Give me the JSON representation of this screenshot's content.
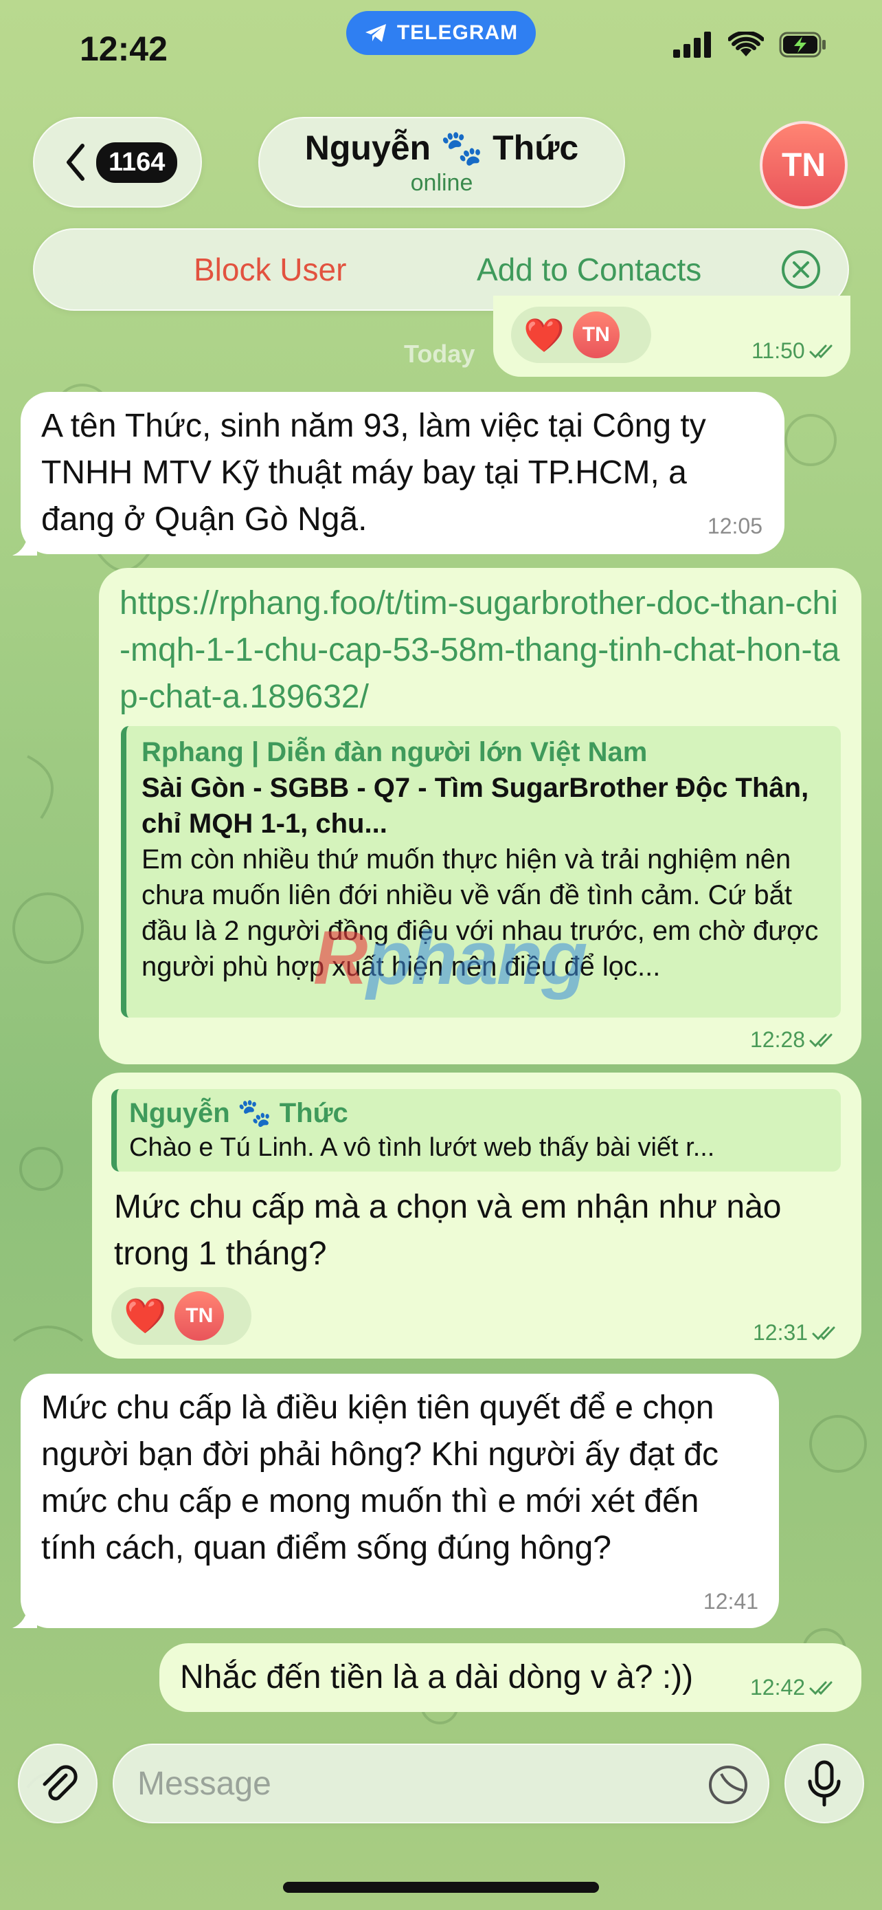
{
  "status_bar": {
    "time": "12:42",
    "source_pill": "TELEGRAM"
  },
  "header": {
    "back_count": "1164",
    "contact_name": "Nguyễn 🐾 Thức",
    "contact_status": "online",
    "avatar_initials": "TN"
  },
  "action_bar": {
    "block_label": "Block User",
    "add_label": "Add to Contacts"
  },
  "date_label": "Today",
  "messages": [
    {
      "id": "m0",
      "direction": "out",
      "time": "11:50",
      "reaction": "❤️",
      "reaction_avatar": "TN"
    },
    {
      "id": "m1",
      "direction": "in",
      "text": "A tên Thức, sinh năm 93, làm việc tại Công ty TNHH MTV Kỹ thuật máy bay tại TP.HCM, a đang ở Quận Gò Ngã.",
      "time": "12:05"
    },
    {
      "id": "m2",
      "direction": "out",
      "link": "https://rphang.foo/t/tim-sugarbrother-doc-than-chi-mqh-1-1-chu-cap-53-58m-thang-tinh-chat-hon-tap-chat-a.189632/",
      "preview": {
        "site": "Rphang | Diễn đàn người lớn Việt Nam",
        "title": "Sài Gòn - SGBB - Q7 - Tìm SugarBrother Độc Thân, chỉ MQH 1-1, chu...",
        "description": "Em còn nhiều thứ muốn thực hiện và trải nghiệm nên chưa muốn liên đới nhiều về vấn đề tình cảm. Cứ bắt đầu là 2 người đồng điệu với nhau trước, em chờ được người phù hợp xuất hiện nên điều để lọc..."
      },
      "watermark": "Rphang",
      "time": "12:28"
    },
    {
      "id": "m3",
      "direction": "out",
      "reply_to": {
        "name": "Nguyễn 🐾 Thức",
        "text": "Chào e Tú Linh. A vô tình lướt web thấy bài viết r..."
      },
      "text": "Mức chu cấp mà a chọn và em nhận như nào trong 1 tháng?",
      "reaction": "❤️",
      "reaction_avatar": "TN",
      "time": "12:31"
    },
    {
      "id": "m4",
      "direction": "in",
      "text": "Mức chu cấp là điều kiện tiên quyết để e chọn người bạn đời phải hông? Khi người ấy đạt đc mức chu cấp e mong muốn thì e mới xét đến tính cách, quan điểm sống đúng hông?",
      "time": "12:41"
    },
    {
      "id": "m5",
      "direction": "out",
      "text": "Nhắc đến tiền là a dài dòng v à? :))",
      "time": "12:42"
    }
  ],
  "input": {
    "placeholder": "Message"
  },
  "icons": {
    "back": "chevron-left-icon",
    "close": "close-circle-icon",
    "attach": "paperclip-icon",
    "sticker": "sticker-icon",
    "mic": "microphone-icon",
    "read": "double-check-icon",
    "signal": "signal-icon",
    "wifi": "wifi-icon",
    "battery": "battery-charging-icon",
    "telegram": "telegram-icon"
  },
  "colors": {
    "incoming": "#ffffff",
    "outgoing": "#eefcd6",
    "accent_green": "#3f9a5b",
    "block_red": "#e2523f",
    "telegram_blue": "#2f7ff2",
    "avatar_red": "#e9545a"
  }
}
